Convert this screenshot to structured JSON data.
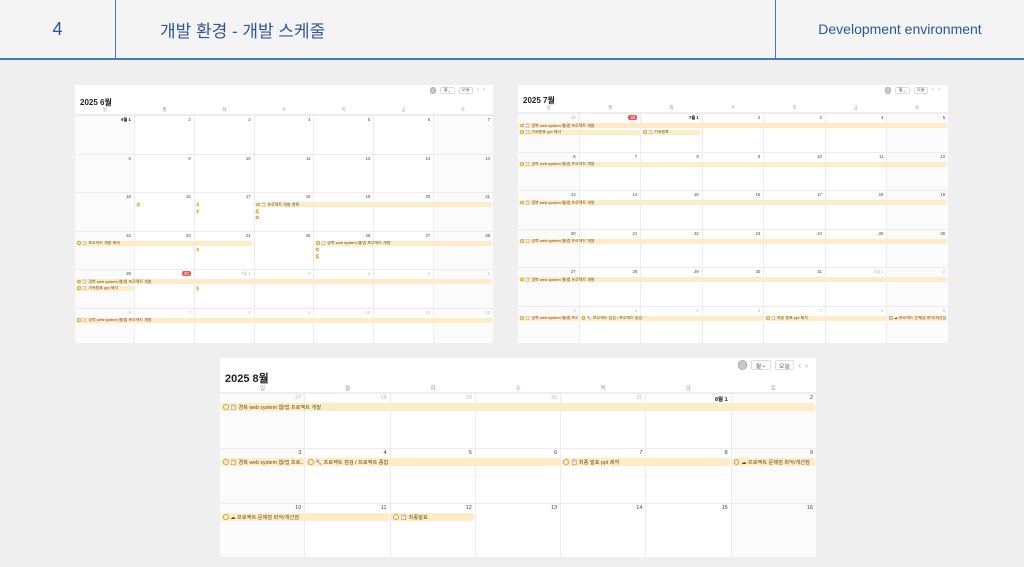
{
  "header": {
    "number": "4",
    "title": "개발 환경 - 개발 스케줄",
    "english_title": "Development environment"
  },
  "weekday_labels": [
    "일",
    "월",
    "화",
    "수",
    "목",
    "금",
    "토"
  ],
  "controls": {
    "view_label": "월",
    "today_label": "오늘",
    "prev_icon": "chevron-left-icon",
    "next_icon": "chevron-right-icon"
  },
  "colors": {
    "event_bg": "#fdecc8",
    "today_badge": "#eb5757",
    "accent": "#2f5597"
  },
  "calendars": [
    {
      "id": "june",
      "title_year": "2025",
      "title_month": "6월",
      "weeks": [
        [
          {
            "d": "6월 1",
            "first": true
          },
          {
            "d": "2"
          },
          {
            "d": "3"
          },
          {
            "d": "4"
          },
          {
            "d": "5"
          },
          {
            "d": "6"
          },
          {
            "d": "7"
          }
        ],
        [
          {
            "d": "8"
          },
          {
            "d": "9"
          },
          {
            "d": "10"
          },
          {
            "d": "11"
          },
          {
            "d": "12"
          },
          {
            "d": "13"
          },
          {
            "d": "14"
          }
        ],
        [
          {
            "d": "15"
          },
          {
            "d": "16"
          },
          {
            "d": "17"
          },
          {
            "d": "18"
          },
          {
            "d": "19"
          },
          {
            "d": "20"
          },
          {
            "d": "21"
          }
        ],
        [
          {
            "d": "22"
          },
          {
            "d": "23"
          },
          {
            "d": "24"
          },
          {
            "d": "25"
          },
          {
            "d": "26"
          },
          {
            "d": "27"
          },
          {
            "d": "28"
          }
        ],
        [
          {
            "d": "29"
          },
          {
            "d": "30",
            "today": true
          },
          {
            "d": "7월 1",
            "muted": true
          },
          {
            "d": "2",
            "muted": true
          },
          {
            "d": "3",
            "muted": true
          },
          {
            "d": "4",
            "muted": true
          },
          {
            "d": "5",
            "muted": true
          }
        ],
        [
          {
            "d": "6",
            "muted": true
          },
          {
            "d": "7",
            "muted": true
          },
          {
            "d": "8",
            "muted": true
          },
          {
            "d": "9",
            "muted": true
          },
          {
            "d": "10",
            "muted": true
          },
          {
            "d": "11",
            "muted": true
          },
          {
            "d": "12",
            "muted": true
          }
        ]
      ],
      "events": [
        {
          "w": 2,
          "s": 1,
          "e": 1,
          "l": 0,
          "t": "📋 기획회의"
        },
        {
          "w": 2,
          "s": 2,
          "e": 2,
          "l": 0,
          "t": "📋 기능 리스트 정리"
        },
        {
          "w": 2,
          "s": 3,
          "e": 7,
          "l": 0,
          "t": "📋 프로젝트 개발 계획"
        },
        {
          "w": 2,
          "s": 2,
          "e": 2,
          "l": 1,
          "t": "📋 기능 상세 설계"
        },
        {
          "w": 2,
          "s": 3,
          "e": 3,
          "l": 1,
          "t": "📋 화면 설계(UI)"
        },
        {
          "w": 2,
          "s": 3,
          "e": 3,
          "l": 2,
          "t": "📋 DB 설계 및 구현"
        },
        {
          "w": 3,
          "s": 0,
          "e": 3,
          "l": 0,
          "t": "📋 프로젝트 개발 계획"
        },
        {
          "w": 3,
          "s": 4,
          "e": 7,
          "l": 0,
          "t": "📋 경북 web system 웹/앱 프로젝트 개발"
        },
        {
          "w": 3,
          "s": 2,
          "e": 2,
          "l": 1,
          "t": "📋 중간 점검 회의"
        },
        {
          "w": 3,
          "s": 4,
          "e": 4,
          "l": 1,
          "t": "📋 기획서 ppt 제작"
        },
        {
          "w": 3,
          "s": 4,
          "e": 4,
          "l": 2,
          "t": "📋 기능 구현 점검"
        },
        {
          "w": 4,
          "s": 0,
          "e": 7,
          "l": 0,
          "t": "📋 경북 web system 웹/앱 프로젝트 개발"
        },
        {
          "w": 4,
          "s": 0,
          "e": 1,
          "l": 1,
          "t": "📋 기획발표 ppt 제작"
        },
        {
          "w": 4,
          "s": 2,
          "e": 2,
          "l": 1,
          "t": "📋 기획발표"
        },
        {
          "w": 5,
          "s": 0,
          "e": 7,
          "l": 0,
          "t": "📋 경북 web system 웹/앱 프로젝트 개발"
        }
      ]
    },
    {
      "id": "july",
      "title_year": "2025",
      "title_month": "7월",
      "weeks": [
        [
          {
            "d": "29",
            "muted": true
          },
          {
            "d": "30",
            "today": true
          },
          {
            "d": "7월 1",
            "first": true
          },
          {
            "d": "2"
          },
          {
            "d": "3"
          },
          {
            "d": "4"
          },
          {
            "d": "5"
          }
        ],
        [
          {
            "d": "6"
          },
          {
            "d": "7"
          },
          {
            "d": "8"
          },
          {
            "d": "9"
          },
          {
            "d": "10"
          },
          {
            "d": "11"
          },
          {
            "d": "12"
          }
        ],
        [
          {
            "d": "13"
          },
          {
            "d": "14"
          },
          {
            "d": "15"
          },
          {
            "d": "16"
          },
          {
            "d": "17"
          },
          {
            "d": "18"
          },
          {
            "d": "19"
          }
        ],
        [
          {
            "d": "20"
          },
          {
            "d": "21"
          },
          {
            "d": "22"
          },
          {
            "d": "23"
          },
          {
            "d": "24"
          },
          {
            "d": "25"
          },
          {
            "d": "26"
          }
        ],
        [
          {
            "d": "27"
          },
          {
            "d": "28"
          },
          {
            "d": "29"
          },
          {
            "d": "30"
          },
          {
            "d": "31"
          },
          {
            "d": "8월 1",
            "muted": true
          },
          {
            "d": "2",
            "muted": true
          }
        ],
        [
          {
            "d": "3",
            "muted": true
          },
          {
            "d": "4",
            "muted": true
          },
          {
            "d": "5",
            "muted": true
          },
          {
            "d": "6",
            "muted": true
          },
          {
            "d": "7",
            "muted": true
          },
          {
            "d": "8",
            "muted": true
          },
          {
            "d": "9",
            "muted": true
          }
        ]
      ],
      "events": [
        {
          "w": 0,
          "s": 0,
          "e": 7,
          "l": 0,
          "t": "📋 경북 web system 웹/앱 프로젝트 개발"
        },
        {
          "w": 0,
          "s": 0,
          "e": 2,
          "l": 1,
          "t": "📋 기획발표 ppt 제작"
        },
        {
          "w": 0,
          "s": 2,
          "e": 3,
          "l": 1,
          "t": "📋 기획발표"
        },
        {
          "w": 1,
          "s": 0,
          "e": 7,
          "l": 0,
          "t": "📋 경북 web system 웹/앱 프로젝트 개발"
        },
        {
          "w": 2,
          "s": 0,
          "e": 7,
          "l": 0,
          "t": "📋 경북 web system 웹/앱 프로젝트 개발"
        },
        {
          "w": 3,
          "s": 0,
          "e": 7,
          "l": 0,
          "t": "📋 경북 web system 웹/앱 프로젝트 개발"
        },
        {
          "w": 4,
          "s": 0,
          "e": 7,
          "l": 0,
          "t": "📋 경북 web system 웹/앱 프로젝트 개발"
        },
        {
          "w": 5,
          "s": 0,
          "e": 1,
          "l": 0,
          "t": "📋 경북 web system 웹/앱 프로..."
        },
        {
          "w": 5,
          "s": 1,
          "e": 4,
          "l": 0,
          "t": "🔧 프로젝트 점검 / 프로젝트 종합"
        },
        {
          "w": 5,
          "s": 4,
          "e": 6,
          "l": 0,
          "t": "📋 최종 발표 ppt 제작"
        },
        {
          "w": 5,
          "s": 6,
          "e": 7,
          "l": 0,
          "t": "☁ 프로젝트 문제점 파악/개선점"
        }
      ]
    },
    {
      "id": "august",
      "title_year": "2025",
      "title_month": "8월",
      "weeks": [
        [
          {
            "d": "27",
            "muted": true
          },
          {
            "d": "28",
            "muted": true
          },
          {
            "d": "29",
            "muted": true
          },
          {
            "d": "30",
            "muted": true
          },
          {
            "d": "31",
            "muted": true
          },
          {
            "d": "8월 1",
            "first": true
          },
          {
            "d": "2"
          }
        ],
        [
          {
            "d": "3"
          },
          {
            "d": "4"
          },
          {
            "d": "5"
          },
          {
            "d": "6"
          },
          {
            "d": "7"
          },
          {
            "d": "8"
          },
          {
            "d": "9"
          }
        ],
        [
          {
            "d": "10"
          },
          {
            "d": "11"
          },
          {
            "d": "12"
          },
          {
            "d": "13"
          },
          {
            "d": "14"
          },
          {
            "d": "15"
          },
          {
            "d": "16"
          }
        ]
      ],
      "events": [
        {
          "w": 0,
          "s": 0,
          "e": 7,
          "l": 0,
          "t": "📋 경북 web system 웹/앱 프로젝트 개발"
        },
        {
          "w": 1,
          "s": 0,
          "e": 1,
          "l": 0,
          "t": "📋 경북 web system 웹/앱 프로..."
        },
        {
          "w": 1,
          "s": 1,
          "e": 4,
          "l": 0,
          "t": "🔧 프로젝트 점검 / 프로젝트 종합"
        },
        {
          "w": 1,
          "s": 4,
          "e": 6,
          "l": 0,
          "t": "📋 최종 발표 ppt 제작"
        },
        {
          "w": 1,
          "s": 6,
          "e": 7,
          "l": 0,
          "t": "☁ 프로젝트 문제점 파악/개선점"
        },
        {
          "w": 2,
          "s": 0,
          "e": 2,
          "l": 0,
          "t": "☁ 프로젝트 문제점 파악/개선점"
        },
        {
          "w": 2,
          "s": 2,
          "e": 3,
          "l": 0,
          "t": "📋 최종발표"
        }
      ]
    }
  ]
}
